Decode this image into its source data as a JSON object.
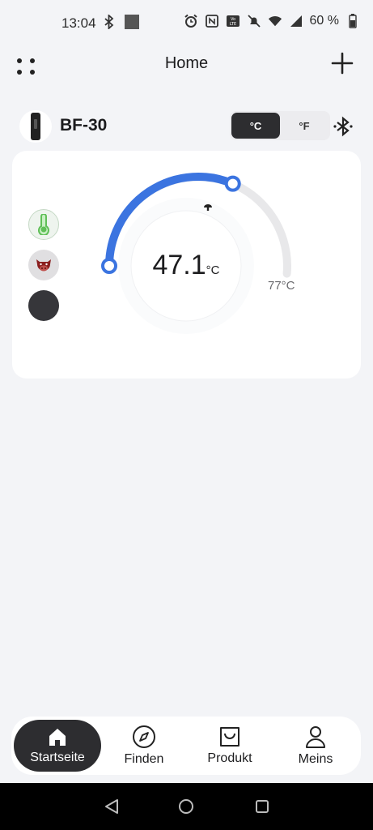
{
  "status_bar": {
    "time": "13:04",
    "battery": "60 %",
    "left_icons": [
      "bluetooth-icon",
      "notification-square-icon"
    ],
    "right_icons": [
      "alarm-icon",
      "nfc-icon",
      "volte-icon",
      "mute-icon",
      "wifi-icon",
      "signal-icon",
      "battery-icon"
    ]
  },
  "header": {
    "title": "Home",
    "menu_icon": "grid-dots-icon",
    "add_icon": "plus-icon"
  },
  "device": {
    "name": "BF-30",
    "units": {
      "celsius": "°C",
      "fahrenheit": "°F",
      "selected": "°C"
    },
    "connection_icon": "bluetooth-icon"
  },
  "probe_card": {
    "current_temp": "47.1",
    "current_unit": "°C",
    "target_temp": "77°C",
    "progress_fraction": 0.61,
    "probes": [
      "thermometer-icon",
      "meat-icon",
      "empty-probe"
    ]
  },
  "colors": {
    "accent": "#3b74e0",
    "dark": "#2d2d30",
    "background": "#f3f4f7"
  },
  "bottom_nav": {
    "items": [
      {
        "label": "Startseite",
        "icon": "home-icon",
        "active": true
      },
      {
        "label": "Finden",
        "icon": "compass-icon"
      },
      {
        "label": "Produkt",
        "icon": "bag-icon"
      },
      {
        "label": "Meins",
        "icon": "person-icon"
      }
    ]
  }
}
